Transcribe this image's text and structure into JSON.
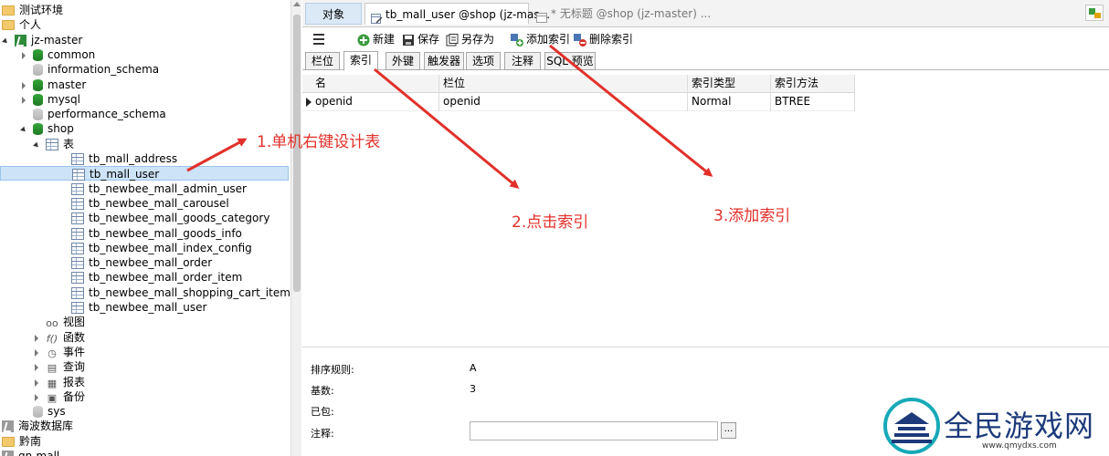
{
  "navigator": {
    "items": [
      {
        "label": "测试环境",
        "icon": "folder-icon",
        "level": 0,
        "twisty": "none"
      },
      {
        "label": "个人",
        "icon": "folder-icon",
        "level": 0,
        "twisty": "none"
      },
      {
        "label": "jz-master",
        "icon": "connection-icon",
        "level": 0,
        "twisty": "open"
      },
      {
        "label": "common",
        "icon": "database-icon",
        "level": 1,
        "twisty": "closed"
      },
      {
        "label": "information_schema",
        "icon": "database-grey-icon",
        "level": 1,
        "twisty": "none"
      },
      {
        "label": "master",
        "icon": "database-icon",
        "level": 1,
        "twisty": "closed"
      },
      {
        "label": "mysql",
        "icon": "database-icon",
        "level": 1,
        "twisty": "closed"
      },
      {
        "label": "performance_schema",
        "icon": "database-grey-icon",
        "level": 1,
        "twisty": "none"
      },
      {
        "label": "shop",
        "icon": "database-icon",
        "level": 1,
        "twisty": "open"
      },
      {
        "label": "表",
        "icon": "tables-icon",
        "level": 2,
        "twisty": "open"
      },
      {
        "label": "tb_mall_address",
        "icon": "table-icon",
        "level": 3,
        "twisty": "none"
      },
      {
        "label": "tb_mall_user",
        "icon": "table-icon",
        "level": 3,
        "twisty": "none",
        "selected": true
      },
      {
        "label": "tb_newbee_mall_admin_user",
        "icon": "table-icon",
        "level": 3,
        "twisty": "none"
      },
      {
        "label": "tb_newbee_mall_carousel",
        "icon": "table-icon",
        "level": 3,
        "twisty": "none"
      },
      {
        "label": "tb_newbee_mall_goods_category",
        "icon": "table-icon",
        "level": 3,
        "twisty": "none"
      },
      {
        "label": "tb_newbee_mall_goods_info",
        "icon": "table-icon",
        "level": 3,
        "twisty": "none"
      },
      {
        "label": "tb_newbee_mall_index_config",
        "icon": "table-icon",
        "level": 3,
        "twisty": "none"
      },
      {
        "label": "tb_newbee_mall_order",
        "icon": "table-icon",
        "level": 3,
        "twisty": "none"
      },
      {
        "label": "tb_newbee_mall_order_item",
        "icon": "table-icon",
        "level": 3,
        "twisty": "none"
      },
      {
        "label": "tb_newbee_mall_shopping_cart_item",
        "icon": "table-icon",
        "level": 3,
        "twisty": "none"
      },
      {
        "label": "tb_newbee_mall_user",
        "icon": "table-icon",
        "level": 3,
        "twisty": "none"
      },
      {
        "label": "视图",
        "icon": "views-icon",
        "level": 2,
        "twisty": "none"
      },
      {
        "label": "函数",
        "icon": "functions-icon",
        "level": 2,
        "twisty": "closed"
      },
      {
        "label": "事件",
        "icon": "events-icon",
        "level": 2,
        "twisty": "closed"
      },
      {
        "label": "查询",
        "icon": "queries-icon",
        "level": 2,
        "twisty": "closed"
      },
      {
        "label": "报表",
        "icon": "reports-icon",
        "level": 2,
        "twisty": "closed"
      },
      {
        "label": "备份",
        "icon": "backups-icon",
        "level": 2,
        "twisty": "closed"
      },
      {
        "label": "sys",
        "icon": "database-grey-icon",
        "level": 1,
        "twisty": "none"
      },
      {
        "label": "海波数据库",
        "icon": "connection-grey-icon",
        "level": 0,
        "twisty": "none"
      },
      {
        "label": "黔南",
        "icon": "folder-icon",
        "level": 0,
        "twisty": "none"
      },
      {
        "label": "qn-mall",
        "icon": "connection-grey-icon",
        "level": 0,
        "twisty": "none"
      }
    ]
  },
  "doc_tabs": {
    "objects": "对象",
    "active": "tb_mall_user @shop (jz-mas...",
    "inactive": "* 无标题 @shop (jz-master) ..."
  },
  "toolbar": {
    "new": "新建",
    "save": "保存",
    "save_as": "另存为",
    "add_index": "添加索引",
    "delete_index": "删除索引"
  },
  "sub_tabs": [
    "栏位",
    "索引",
    "外键",
    "触发器",
    "选项",
    "注释",
    "SQL 预览"
  ],
  "index_grid": {
    "columns": [
      "名",
      "栏位",
      "索引类型",
      "索引方法"
    ],
    "rows": [
      {
        "name": "openid",
        "fields": "openid",
        "index_type": "Normal",
        "index_method": "BTREE"
      }
    ]
  },
  "properties": {
    "collation_label": "排序规则:",
    "collation_value": "A",
    "cardinality_label": "基数:",
    "cardinality_value": "3",
    "packed_label": "已包:",
    "comment_label": "注释:",
    "comment_value": "",
    "ellipsis": "..."
  },
  "annotations": {
    "step1": "1.单机右键设计表",
    "step2": "2.点击索引",
    "step3": "3.添加索引",
    "color": "#e2302a"
  },
  "watermark": {
    "text": "全民游戏网",
    "url": "www.qmydxs.com"
  }
}
